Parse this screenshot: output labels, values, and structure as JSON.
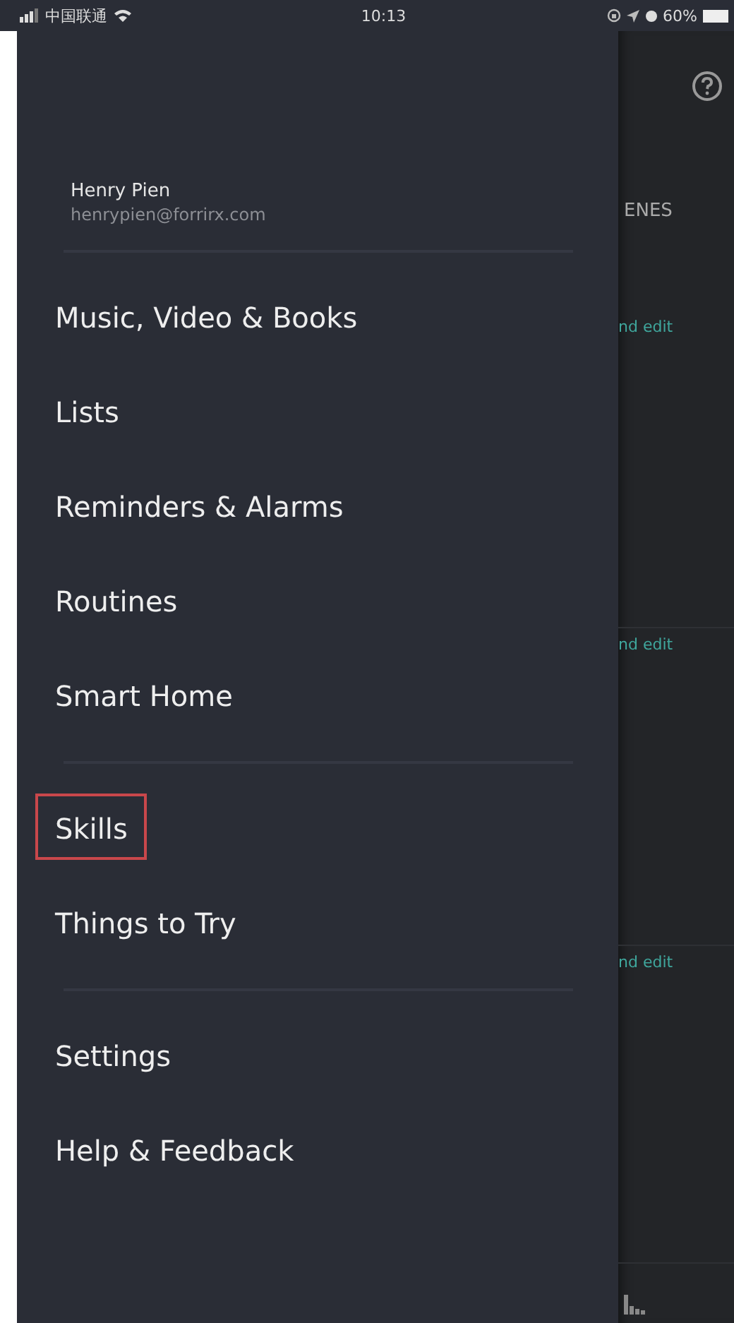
{
  "status_bar": {
    "carrier": "中国联通",
    "time": "10:13",
    "battery": "60%"
  },
  "background": {
    "tab_label": "ENES",
    "cards": [
      {
        "action": "nd edit"
      },
      {
        "action": "nd edit"
      },
      {
        "action": "nd edit"
      }
    ]
  },
  "profile": {
    "name": "Henry Pien",
    "email": "henrypien@forrirx.com"
  },
  "menu_groups": [
    {
      "items": [
        {
          "label": "Music, Video & Books",
          "selected": false
        },
        {
          "label": "Lists",
          "selected": false
        },
        {
          "label": "Reminders & Alarms",
          "selected": false
        },
        {
          "label": "Routines",
          "selected": false
        },
        {
          "label": "Smart Home",
          "selected": false
        }
      ]
    },
    {
      "items": [
        {
          "label": "Skills",
          "selected": true
        },
        {
          "label": "Things to Try",
          "selected": false
        }
      ]
    },
    {
      "items": [
        {
          "label": "Settings",
          "selected": false
        },
        {
          "label": "Help & Feedback",
          "selected": false
        }
      ]
    }
  ]
}
